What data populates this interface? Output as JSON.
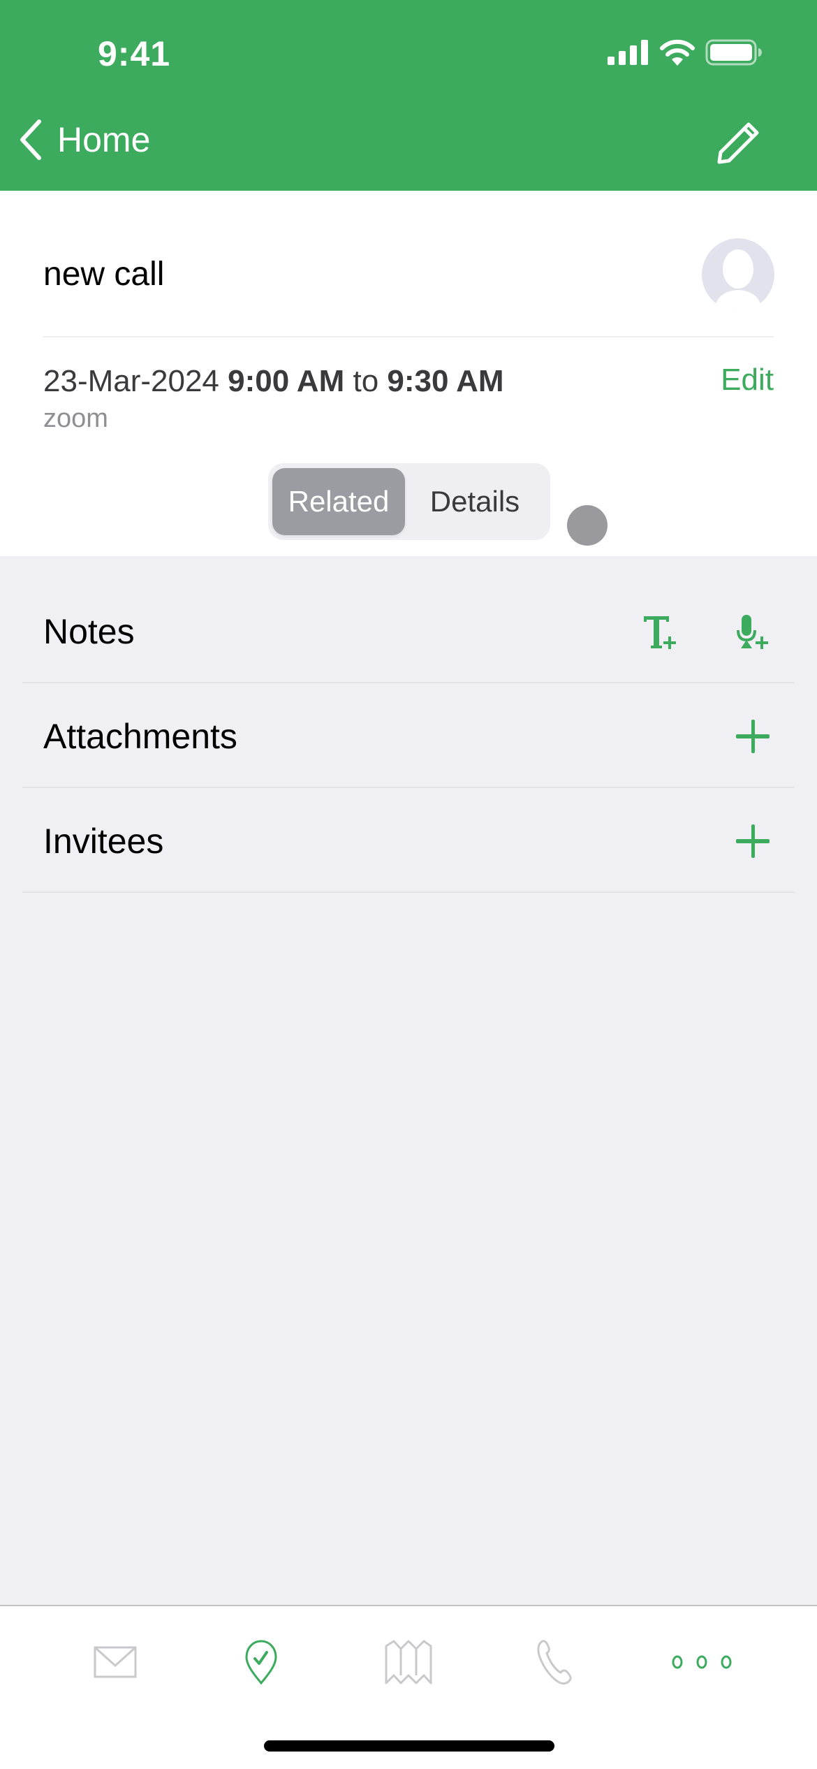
{
  "status_bar": {
    "time": "9:41"
  },
  "nav": {
    "back_label": "Home",
    "back_icon": "chevron-left-icon",
    "edit_icon": "pencil-icon"
  },
  "record": {
    "title": "new call",
    "date": "23-Mar-2024",
    "start_time": "9:00 AM",
    "to_label": "to",
    "end_time": "9:30 AM",
    "location": "zoom",
    "edit_label": "Edit"
  },
  "segment": {
    "options": [
      {
        "label": "Related",
        "selected": true
      },
      {
        "label": "Details",
        "selected": false
      }
    ]
  },
  "sections": [
    {
      "label": "Notes",
      "actions": [
        "add-text-note-icon",
        "add-voice-note-icon"
      ]
    },
    {
      "label": "Attachments",
      "actions": [
        "plus-icon"
      ]
    },
    {
      "label": "Invitees",
      "actions": [
        "plus-icon"
      ]
    }
  ],
  "tabbar": {
    "items": [
      {
        "icon": "mail-icon",
        "active": false
      },
      {
        "icon": "location-check-icon",
        "active": true
      },
      {
        "icon": "map-icon",
        "active": false
      },
      {
        "icon": "phone-icon",
        "active": false
      },
      {
        "icon": "more-icon",
        "active": true
      }
    ]
  },
  "colors": {
    "brand": "#3dab5e",
    "background": "#f0eff4",
    "inactive_icon": "#c9c9cc"
  }
}
